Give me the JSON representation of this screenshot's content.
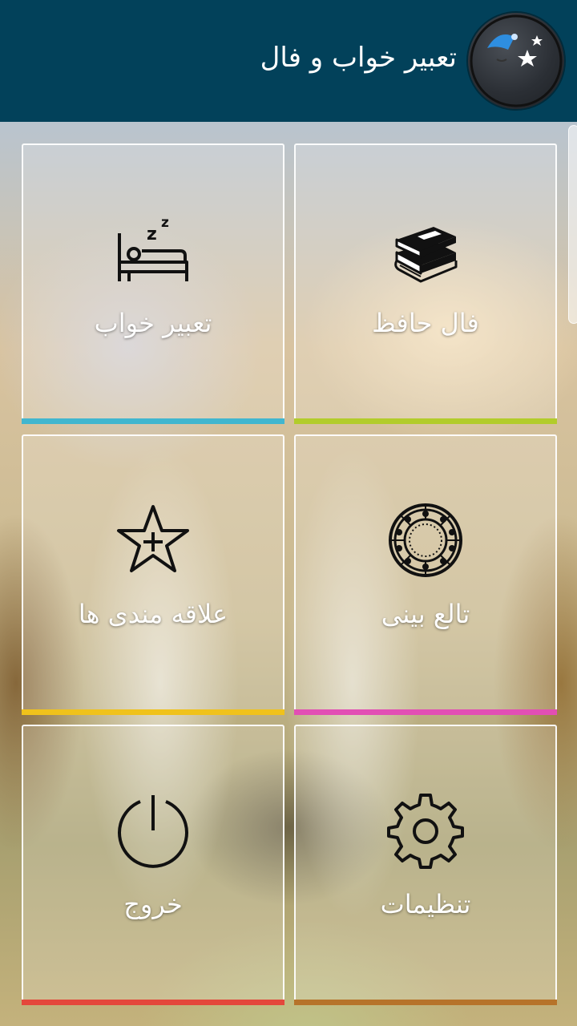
{
  "header": {
    "title": "تعبیر خواب و فال",
    "background_color": "#02415a",
    "logo_icon": "moon-sleeping-icon"
  },
  "tiles": [
    {
      "label": "فال حافظ",
      "icon": "books-icon",
      "bar_color": "#b2cc2b"
    },
    {
      "label": "تعبیر خواب",
      "icon": "bed-sleeping-icon",
      "bar_color": "#41b6cf"
    },
    {
      "label": "تالع بینی",
      "icon": "zodiac-wheel-icon",
      "bar_color": "#e24fb4"
    },
    {
      "label": "علاقه مندی ها",
      "icon": "star-plus-icon",
      "bar_color": "#f0c21b"
    },
    {
      "label": "تنظیمات",
      "icon": "gear-icon",
      "bar_color": "#b6732a"
    },
    {
      "label": "خروج",
      "icon": "power-icon",
      "bar_color": "#e4473b"
    }
  ]
}
